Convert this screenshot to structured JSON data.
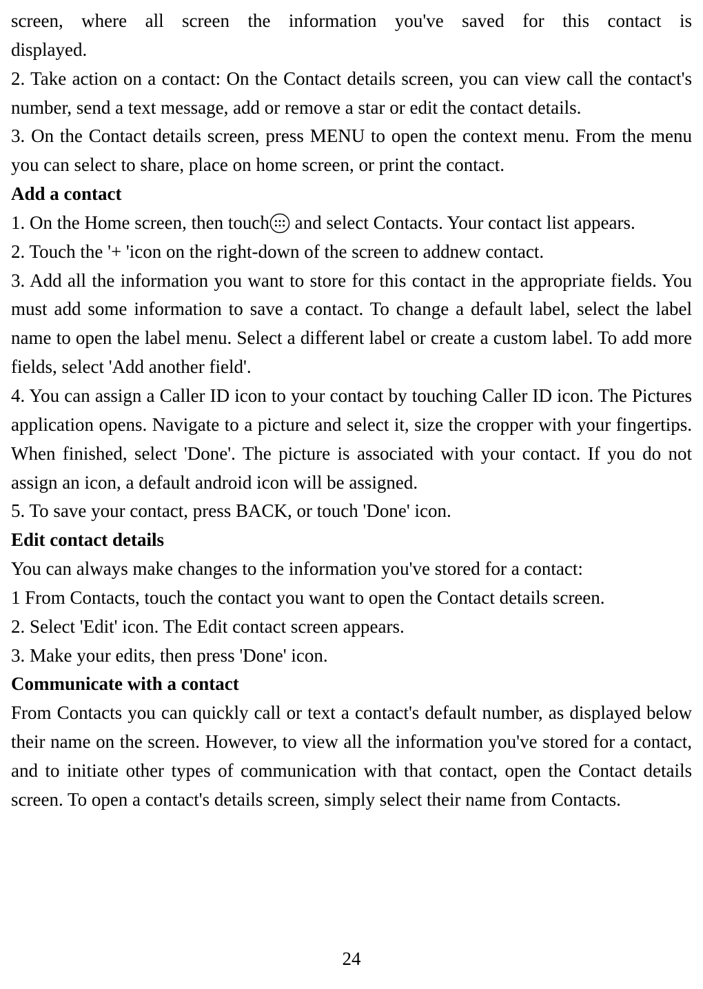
{
  "paragraphs": {
    "p0_line1": "screen, where all screen the information you've saved for this contact is",
    "p0_line2": "displayed.",
    "p1": "2. Take action on a contact: On the Contact details screen, you can view call the contact's number, send a text message, add or remove a star or edit the contact details.",
    "p2": "3. On the Contact details screen, press MENU to open the context menu. From the menu you can select to share, place on home screen, or print the contact.",
    "h1": "Add a contact",
    "p3a": "1. On the Home screen, then touch",
    "p3b": " and select Contacts. Your contact list appears.",
    "p4": "2. Touch the '+ 'icon on the right-down of the screen to addnew contact.",
    "p5": "3. Add all the information you want to store for this contact in the appropriate fields. You must add some information to save a contact. To change a default label, select the label name to open the label menu. Select a different label or create a custom label. To add more fields, select 'Add another field'.",
    "p6": "4. You can assign a Caller ID icon to your contact by touching Caller ID icon. The Pictures application opens. Navigate to a picture and select it, size the cropper with your fingertips. When finished, select 'Done'. The picture is associated with your contact. If you do not assign an icon, a default android icon will be assigned.",
    "p7": "5. To save your contact, press BACK, or touch 'Done' icon.",
    "h2": "Edit contact details",
    "p8": "You can always make changes to the information you've stored for a contact:",
    "p9": "1 From Contacts, touch the contact you want to open the Contact details screen.",
    "p10": "2. Select 'Edit' icon. The Edit contact screen appears.",
    "p11": "3. Make your edits, then press 'Done' icon.",
    "h3": "Communicate with a contact",
    "p12": "From Contacts you can quickly call or text a contact's default number, as displayed below their name on the screen. However, to view all the information you've stored for a contact, and to initiate other types of communication with that contact, open the Contact details screen. To open a contact's details screen, simply select their name from Contacts."
  },
  "pageNumber": "24"
}
